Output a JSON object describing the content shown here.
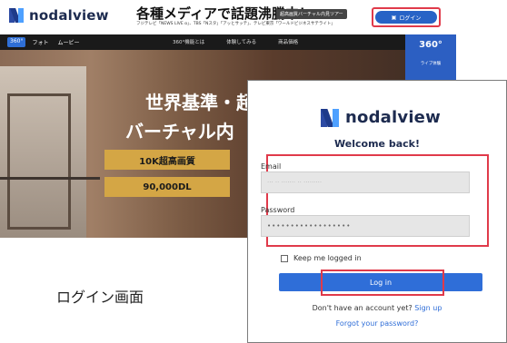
{
  "site": {
    "brand": "nodalview",
    "headline": "各種メディアで話題沸騰中！",
    "promo_pill": "超高画質バーチャル内見ツアー",
    "subline": "フジテレビ「NEWS LIVE α」、TBS「Nスタ」「アッとサッテ」、テレビ東京「ワールドビジネスサテライト」",
    "login_button": "ログイン",
    "nav_left": [
      "360°",
      "フォト",
      "ムービー"
    ],
    "nav_center": [
      "360°機能とは",
      "体験してみる",
      "商品価格"
    ],
    "hero_title_line1": "世界基準・超",
    "hero_title_line2": "バーチャル内",
    "hero_chip_1": "10K超高画質",
    "hero_chip_2": "90,000DL",
    "sidebar_360": "360°",
    "sidebar_360_sub": "ライブ体験"
  },
  "caption": "ログイン画面",
  "modal": {
    "brand": "nodalview",
    "welcome": "Welcome back!",
    "email_label": "Email",
    "email_value": "··· ·· ······· ·· ·········",
    "password_label": "Password",
    "password_value": "••••••••••••••••••",
    "keep_logged_in": "Keep me logged in",
    "login_button": "Log in",
    "signup_prompt": "Don't have an account yet?",
    "signup_link": "Sign up",
    "forgot_link": "Forgot your password?"
  },
  "colors": {
    "brand_blue": "#2f6ed8",
    "highlight_red": "#e03a4a",
    "chip_gold": "#d4a645"
  }
}
